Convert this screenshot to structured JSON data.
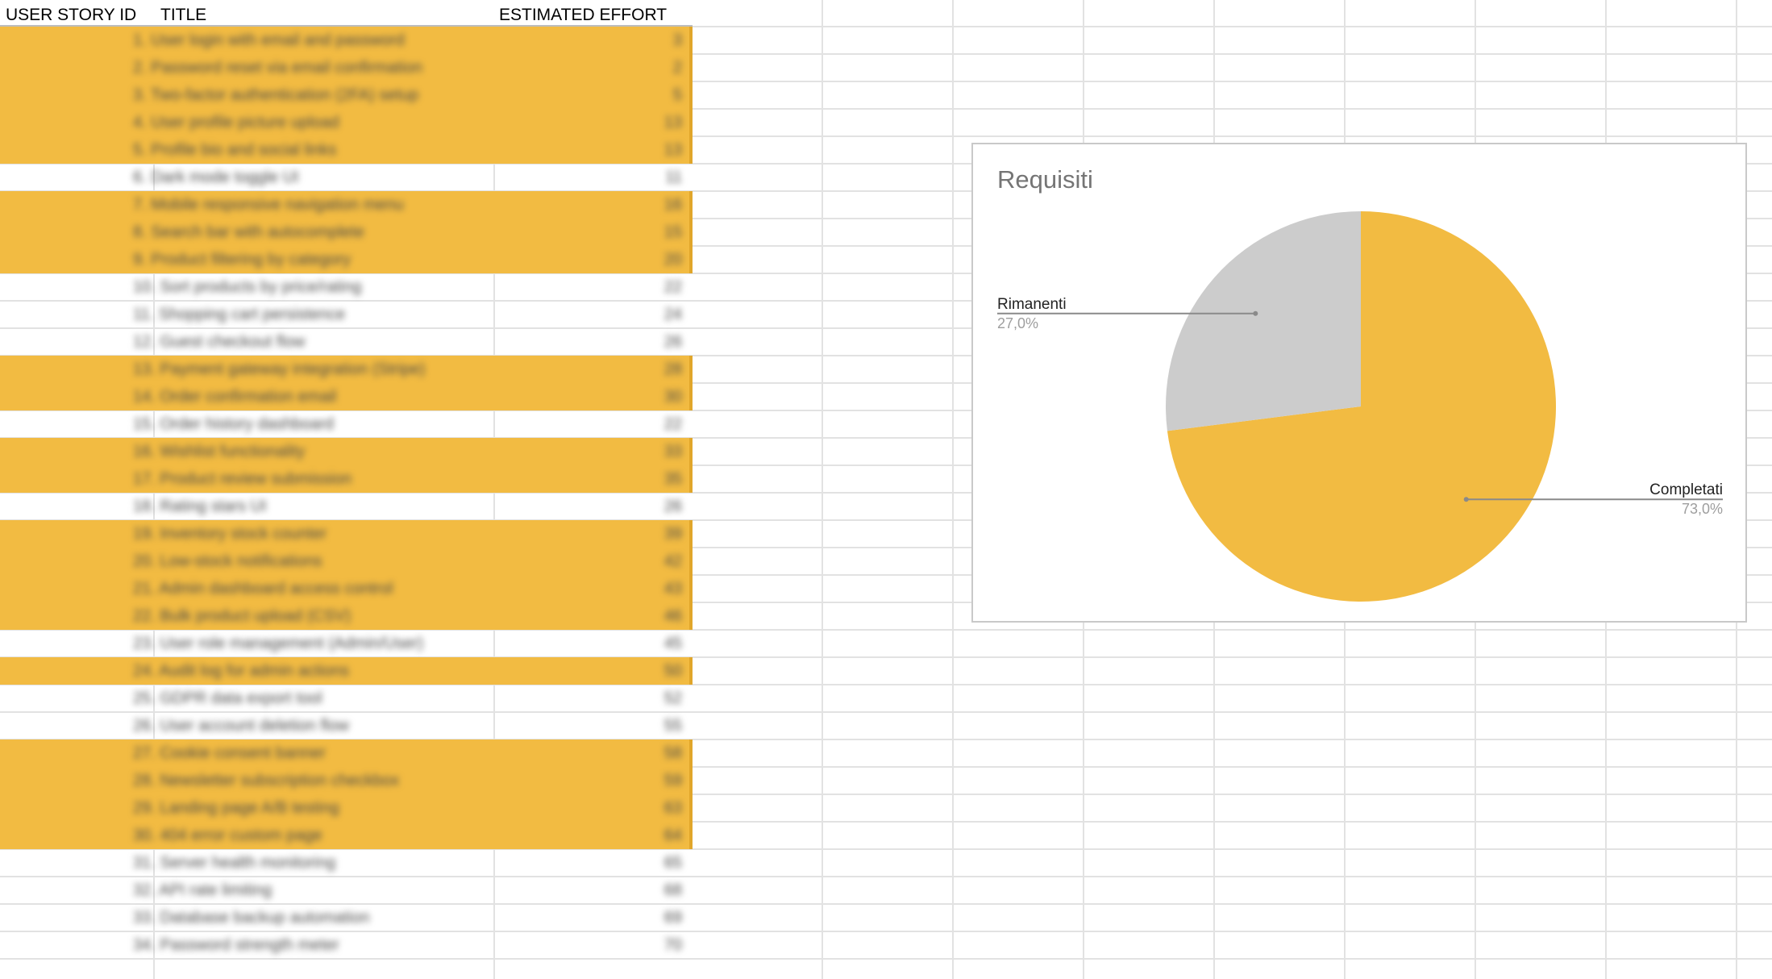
{
  "sheet": {
    "headers": [
      "USER STORY ID",
      "TITLE",
      "ESTIMATED EFFORT"
    ],
    "rows": [
      {
        "title": "1. User login with email and password",
        "effort": "3",
        "done": true
      },
      {
        "title": "2. Password reset via email confirmation",
        "effort": "2",
        "done": true
      },
      {
        "title": "3. Two-factor authentication (2FA) setup",
        "effort": "5",
        "done": true
      },
      {
        "title": "4. User profile picture upload",
        "effort": "13",
        "done": true
      },
      {
        "title": "5. Profile bio and social links",
        "effort": "13",
        "done": true
      },
      {
        "title": "6. Dark mode toggle UI",
        "effort": "11",
        "done": false
      },
      {
        "title": "7. Mobile responsive navigation menu",
        "effort": "16",
        "done": true
      },
      {
        "title": "8. Search bar with autocomplete",
        "effort": "15",
        "done": true
      },
      {
        "title": "9. Product filtering by category",
        "effort": "20",
        "done": true
      },
      {
        "title": "10. Sort products by price/rating",
        "effort": "22",
        "done": false
      },
      {
        "title": "11. Shopping cart persistence",
        "effort": "24",
        "done": false
      },
      {
        "title": "12. Guest checkout flow",
        "effort": "26",
        "done": false
      },
      {
        "title": "13. Payment gateway integration (Stripe)",
        "effort": "28",
        "done": true
      },
      {
        "title": "14. Order confirmation email",
        "effort": "30",
        "done": true
      },
      {
        "title": "15. Order history dashboard",
        "effort": "22",
        "done": false
      },
      {
        "title": "16. Wishlist functionality",
        "effort": "33",
        "done": true
      },
      {
        "title": "17. Product review submission",
        "effort": "35",
        "done": true
      },
      {
        "title": "18. Rating stars UI",
        "effort": "26",
        "done": false
      },
      {
        "title": "19. Inventory stock counter",
        "effort": "39",
        "done": true
      },
      {
        "title": "20. Low-stock notifications",
        "effort": "42",
        "done": true
      },
      {
        "title": "21. Admin dashboard access control",
        "effort": "43",
        "done": true
      },
      {
        "title": "22. Bulk product upload (CSV)",
        "effort": "46",
        "done": true
      },
      {
        "title": "23. User role management (Admin/User)",
        "effort": "45",
        "done": false
      },
      {
        "title": "24. Audit log for admin actions",
        "effort": "50",
        "done": true
      },
      {
        "title": "25. GDPR data export tool",
        "effort": "52",
        "done": false
      },
      {
        "title": "26. User account deletion flow",
        "effort": "55",
        "done": false
      },
      {
        "title": "27. Cookie consent banner",
        "effort": "58",
        "done": true
      },
      {
        "title": "28. Newsletter subscription checkbox",
        "effort": "59",
        "done": true
      },
      {
        "title": "29. Landing page A/B testing",
        "effort": "63",
        "done": true
      },
      {
        "title": "30. 404 error custom page",
        "effort": "64",
        "done": true
      },
      {
        "title": "31. Server health monitoring",
        "effort": "65",
        "done": false
      },
      {
        "title": "32. API rate limiting",
        "effort": "68",
        "done": false
      },
      {
        "title": "33. Database backup automation",
        "effort": "69",
        "done": false
      },
      {
        "title": "34. Password strength meter",
        "effort": "70",
        "done": false
      }
    ]
  },
  "chart_data": {
    "type": "pie",
    "title": "Requisiti",
    "slices": [
      {
        "label": "Completati",
        "value": 73.0,
        "percent_label": "73,0%",
        "color": "#f2bb42"
      },
      {
        "label": "Rimanenti",
        "value": 27.0,
        "percent_label": "27,0%",
        "color": "#cccccc"
      }
    ],
    "legend": "labels-with-leader-lines"
  },
  "colors": {
    "highlight": "#f2bb42",
    "grid": "#e2e2e2"
  }
}
